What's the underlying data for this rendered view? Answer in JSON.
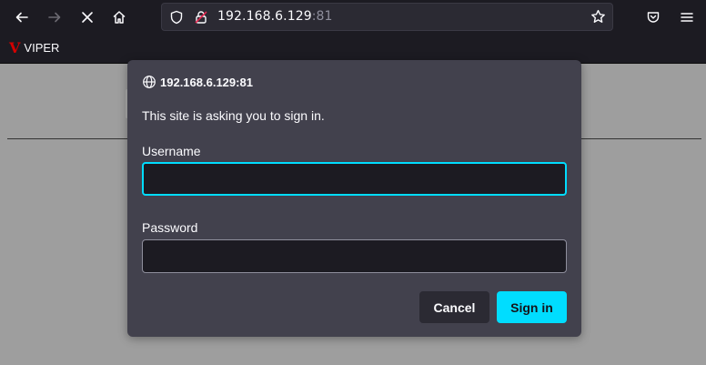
{
  "toolbar": {
    "back_icon": "arrow-left-icon",
    "forward_icon": "arrow-right-icon",
    "stop_icon": "close-icon",
    "home_icon": "home-icon",
    "url_host": "192.168.6.129",
    "url_port": ":81",
    "bookmark_star_icon": "star-icon",
    "pocket_icon": "pocket-icon",
    "menu_icon": "hamburger-menu-icon"
  },
  "bookmarks": {
    "items": [
      {
        "mark": "V",
        "label": "VIPER",
        "mark_color": "#d50000"
      }
    ]
  },
  "dialog": {
    "origin": "192.168.6.129:81",
    "message": "This site is asking you to sign in.",
    "username_label": "Username",
    "username_value": "",
    "password_label": "Password",
    "password_value": "",
    "cancel_label": "Cancel",
    "signin_label": "Sign in"
  },
  "colors": {
    "accent": "#00ddff",
    "dialog_bg": "#42414d",
    "chrome_bg": "#1c1b22"
  }
}
